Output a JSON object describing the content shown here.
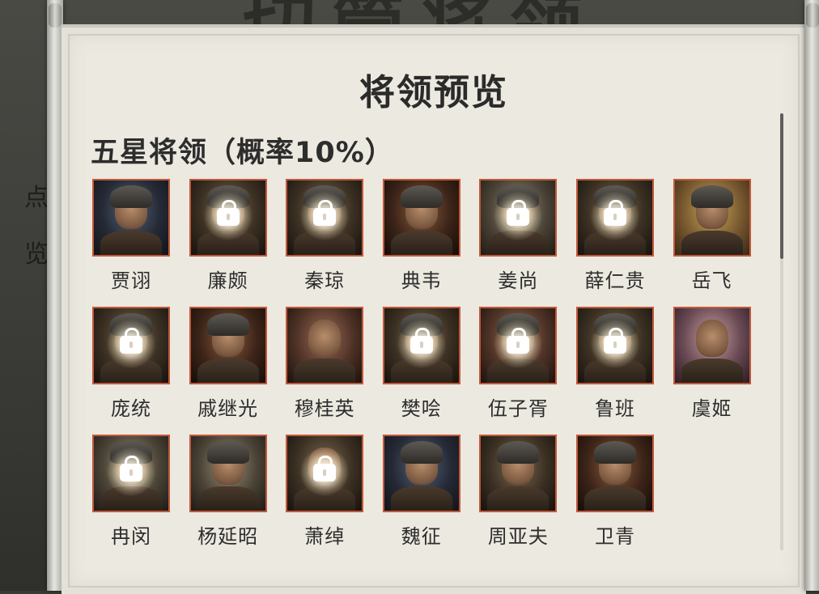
{
  "background": {
    "title_glyphs": "切管将领",
    "side_glyphs": [
      "点",
      "览"
    ]
  },
  "panel": {
    "title": "将领预览",
    "section_header": "五星将领（概率10%）"
  },
  "colors": {
    "portrait_border": "#c0593b",
    "parchment": "#ece9e0",
    "text": "#2d2d2d"
  },
  "generals": [
    {
      "name": "贾诩",
      "locked": false
    },
    {
      "name": "廉颇",
      "locked": true
    },
    {
      "name": "秦琼",
      "locked": true
    },
    {
      "name": "典韦",
      "locked": false
    },
    {
      "name": "姜尚",
      "locked": true
    },
    {
      "name": "薛仁贵",
      "locked": true
    },
    {
      "name": "岳飞",
      "locked": false
    },
    {
      "name": "庞统",
      "locked": true
    },
    {
      "name": "戚继光",
      "locked": false
    },
    {
      "name": "穆桂英",
      "locked": false
    },
    {
      "name": "樊哙",
      "locked": true
    },
    {
      "name": "伍子胥",
      "locked": true
    },
    {
      "name": "鲁班",
      "locked": true
    },
    {
      "name": "虞姬",
      "locked": false
    },
    {
      "name": "冉闵",
      "locked": true
    },
    {
      "name": "杨延昭",
      "locked": false
    },
    {
      "name": "萧绰",
      "locked": true
    },
    {
      "name": "魏征",
      "locked": false
    },
    {
      "name": "周亚夫",
      "locked": false
    },
    {
      "name": "卫青",
      "locked": false
    }
  ]
}
